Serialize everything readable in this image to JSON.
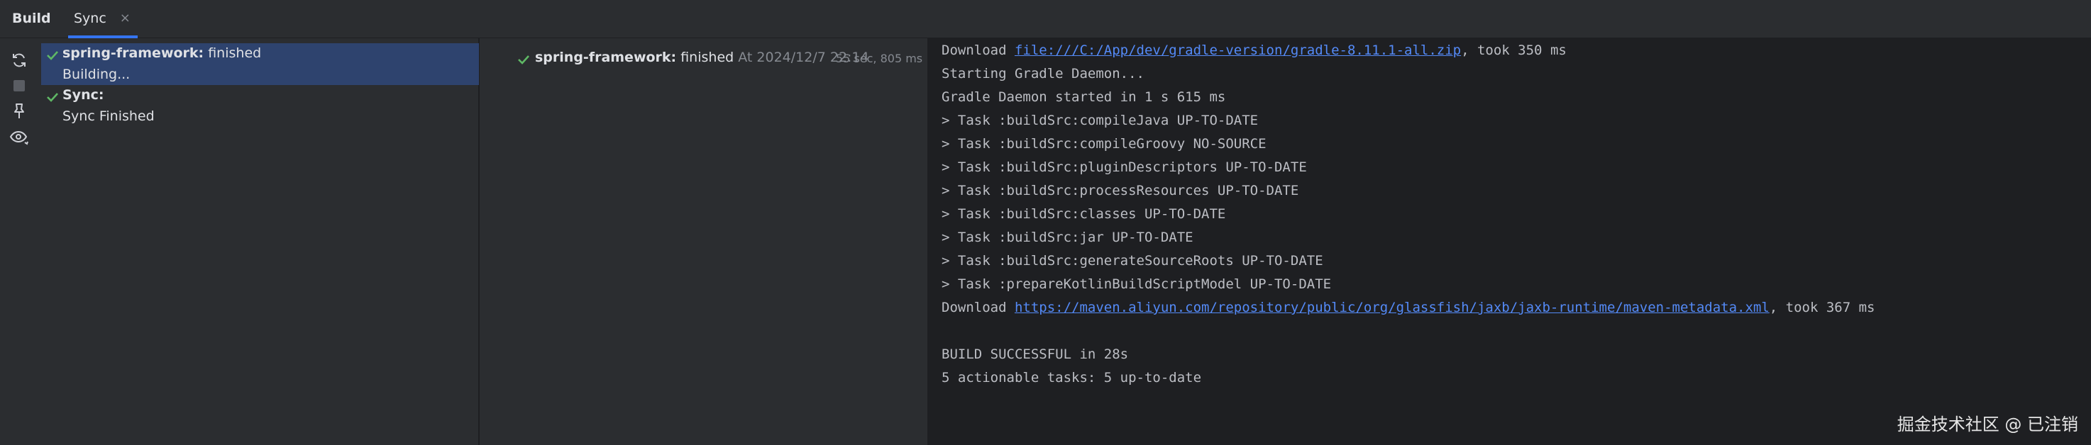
{
  "tabs": {
    "build_label": "Build",
    "sync_label": "Sync",
    "close_glyph": "×"
  },
  "toolbar": {
    "icons": [
      "sync-icon",
      "stop-icon",
      "pin-icon",
      "eye-icon"
    ]
  },
  "tree": {
    "items": [
      {
        "name": "spring-framework:",
        "status": " finished",
        "sub": "Building..."
      },
      {
        "name": "Sync:",
        "status": "",
        "sub": "Sync Finished"
      }
    ]
  },
  "detail": {
    "name": "spring-framework:",
    "status": " finished",
    "at": " At 2024/12/7 22:14",
    "duration": "55 sec, 805 ms"
  },
  "console": {
    "line1_prefix": "Download ",
    "line1_link": "file:///C:/App/dev/gradle-version/gradle-8.11.1-all.zip",
    "line1_suffix": ", took 350 ms",
    "line2": "Starting Gradle Daemon...",
    "line3": "Gradle Daemon started in 1 s 615 ms",
    "line4": "> Task :buildSrc:compileJava UP-TO-DATE",
    "line5": "> Task :buildSrc:compileGroovy NO-SOURCE",
    "line6": "> Task :buildSrc:pluginDescriptors UP-TO-DATE",
    "line7": "> Task :buildSrc:processResources UP-TO-DATE",
    "line8": "> Task :buildSrc:classes UP-TO-DATE",
    "line9": "> Task :buildSrc:jar UP-TO-DATE",
    "line10": "> Task :buildSrc:generateSourceRoots UP-TO-DATE",
    "line11": "> Task :prepareKotlinBuildScriptModel UP-TO-DATE",
    "line12_prefix": "Download ",
    "line12_link": "https://maven.aliyun.com/repository/public/org/glassfish/jaxb/jaxb-runtime/maven-metadata.xml",
    "line12_suffix": ", took 367 ms",
    "line13": "BUILD SUCCESSFUL in 28s",
    "line14": "5 actionable tasks: 5 up-to-date"
  },
  "watermark": "掘金技术社区 @ 已注销",
  "colors": {
    "accent": "#3574f0",
    "success": "#5fb865",
    "link": "#548af7",
    "selection": "#2e436e"
  }
}
